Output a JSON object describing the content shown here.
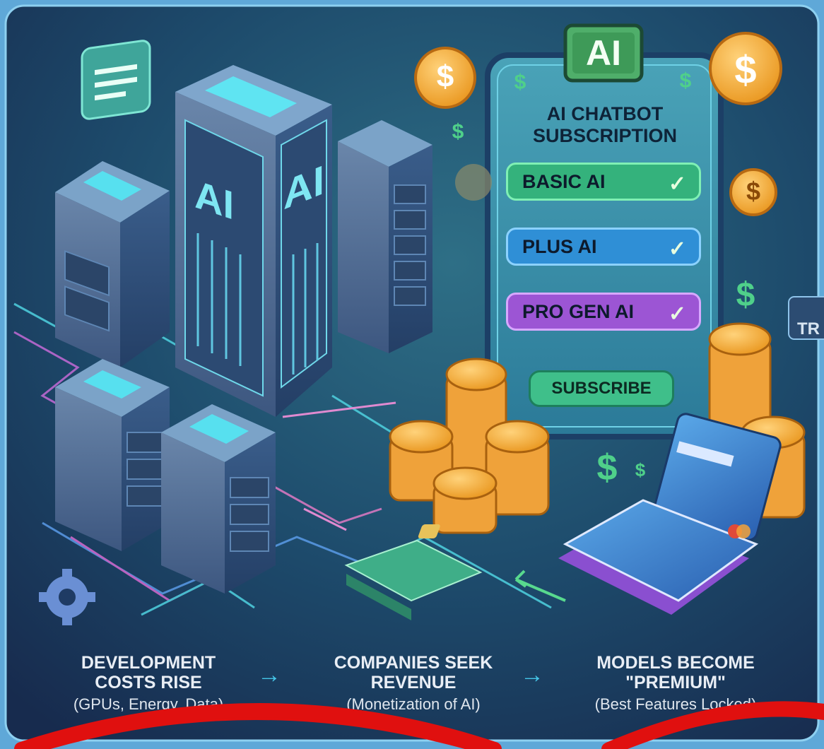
{
  "panel": {
    "badge": "AI",
    "title_line1": "AI CHATBOT",
    "title_line2": "SUBSCRIPTION",
    "plans": [
      {
        "label": "BASIC AI",
        "color": "#34b27c"
      },
      {
        "label": "PLUS AI",
        "color": "#2f8fd6"
      },
      {
        "label": "PRO GEN AI",
        "color": "#9c55d4"
      }
    ],
    "check_symbol": "✓",
    "subscribe_label": "SUBSCRIBE"
  },
  "tower_labels": {
    "left": "AI",
    "right": "AI"
  },
  "side_text": "TR",
  "dollar": "$",
  "steps": [
    {
      "title_line1": "DEVELOPMENT",
      "title_line2": "COSTS RISE",
      "subtitle": "(GPUs, Energy, Data)"
    },
    {
      "title_line1": "COMPANIES SEEK",
      "title_line2": "REVENUE",
      "subtitle": "(Monetization of AI)"
    },
    {
      "title_line1": "MODELS BECOME",
      "title_line2": "\"PREMIUM\"",
      "subtitle": "(Best Features Locked)"
    }
  ],
  "arrow_symbol": "→",
  "colors": {
    "frame": "#5fa8d8",
    "background": "#1b3556",
    "accent": "#45c6e8",
    "annotation": "#e0100f"
  }
}
